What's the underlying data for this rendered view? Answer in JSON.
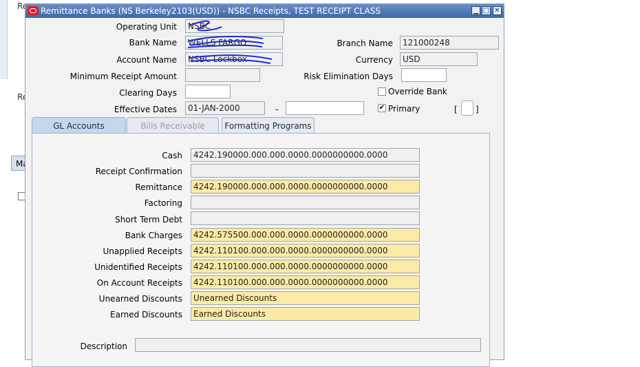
{
  "background": {
    "labels": [
      "Re",
      "Re",
      "Ma"
    ]
  },
  "window": {
    "title": "Remittance Banks (NS Berkeley2103(USD)) - NSBC Receipts, TEST RECEIPT CLASS",
    "minimize": "▁",
    "maximize": "□",
    "close": "✕"
  },
  "header": {
    "operating_unit_label": "Operating Unit",
    "operating_unit_value": "NSBC",
    "bank_name_label": "Bank Name",
    "bank_name_value": "WELLS FARGO",
    "account_name_label": "Account Name",
    "account_name_value": "NSBC Lockbox",
    "min_receipt_label": "Minimum Receipt Amount",
    "min_receipt_value": "",
    "clearing_days_label": "Clearing Days",
    "clearing_days_value": "",
    "effective_dates_label": "Effective Dates",
    "effective_from": "01-JAN-2000",
    "date_separator": "-",
    "effective_to": "",
    "branch_name_label": "Branch Name",
    "branch_name_value": "121000248",
    "currency_label": "Currency",
    "currency_value": "USD",
    "risk_days_label": "Risk Elimination Days",
    "risk_days_value": "",
    "override_bank_label": "Override Bank",
    "override_bank_checked": false,
    "primary_label": "Primary",
    "primary_checked": true,
    "bracket_open": "[",
    "bracket_close": "]"
  },
  "tabs": [
    {
      "label": "GL Accounts",
      "state": "active"
    },
    {
      "label": "Bills Receivable",
      "state": "disabled"
    },
    {
      "label": "Formatting Programs",
      "state": "normal"
    }
  ],
  "gl_accounts": [
    {
      "label": "Cash",
      "value": "4242.190000.000.000.0000.0000000000.0000",
      "required": false
    },
    {
      "label": "Receipt Confirmation",
      "value": "",
      "required": false
    },
    {
      "label": "Remittance",
      "value": "4242.190000.000.000.0000.0000000000.0000",
      "required": true
    },
    {
      "label": "Factoring",
      "value": "",
      "required": false
    },
    {
      "label": "Short Term Debt",
      "value": "",
      "required": false
    },
    {
      "label": "Bank Charges",
      "value": "4242.575500.000.000.0000.0000000000.0000",
      "required": true
    },
    {
      "label": "Unapplied Receipts",
      "value": "4242.110100.000.000.0000.0000000000.0000",
      "required": true
    },
    {
      "label": "Unidentified Receipts",
      "value": "4242.110100.000.000.0000.0000000000.0000",
      "required": true
    },
    {
      "label": "On Account Receipts",
      "value": "4242.110100.000.000.0000.0000000000.0000",
      "required": true
    },
    {
      "label": "Unearned Discounts",
      "value": "Unearned Discounts",
      "required": true
    },
    {
      "label": "Earned Discounts",
      "value": "Earned Discounts",
      "required": true
    }
  ],
  "description": {
    "label": "Description",
    "value": ""
  },
  "colors": {
    "title_bar": "#3d68ab",
    "required_field": "#fbeaa5",
    "active_tab": "#c5d7ec",
    "scribble": "#1d2bd6"
  }
}
